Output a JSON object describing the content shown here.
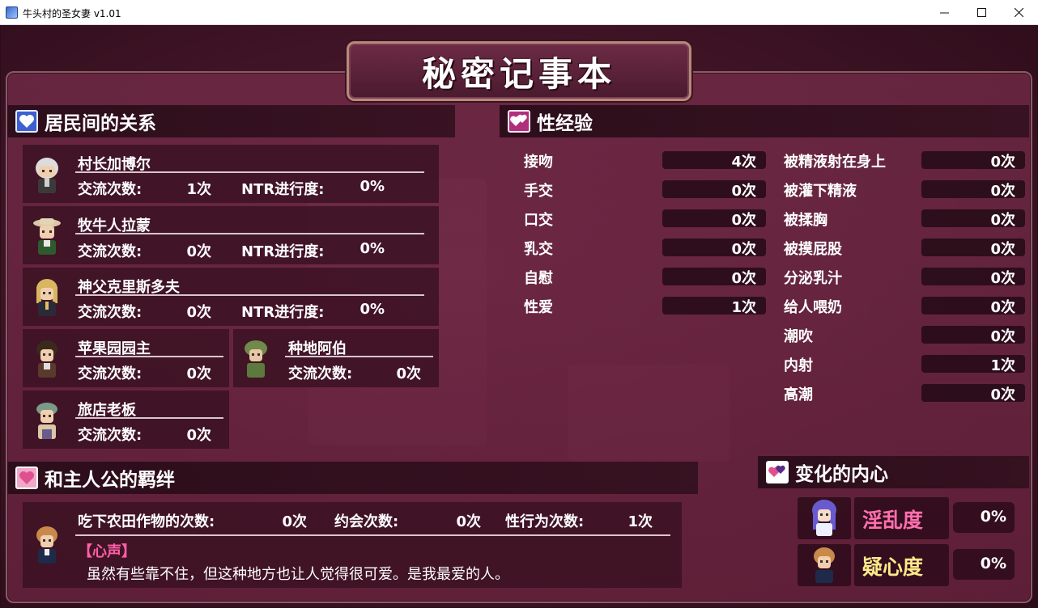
{
  "window": {
    "title": "牛头村的圣女妻 v1.01",
    "minimize": "—",
    "maximize": "☐",
    "close": "✕"
  },
  "page_title": "秘密记事本",
  "relations": {
    "header": "居民间的关系",
    "talk_label": "交流次数:",
    "ntr_label": "NTR进行度:",
    "residents": [
      {
        "name": "村长加博尔",
        "talk": "1次",
        "ntr": "0%"
      },
      {
        "name": "牧牛人拉蒙",
        "talk": "0次",
        "ntr": "0%"
      },
      {
        "name": "神父克里斯多夫",
        "talk": "0次",
        "ntr": "0%"
      },
      {
        "name": "苹果园园主",
        "talk": "0次"
      },
      {
        "name": "种地阿伯",
        "talk": "0次"
      },
      {
        "name": "旅店老板",
        "talk": "0次"
      }
    ]
  },
  "experience": {
    "header": "性经验",
    "left": [
      {
        "label": "接吻",
        "value": "4次"
      },
      {
        "label": "手交",
        "value": "0次"
      },
      {
        "label": "口交",
        "value": "0次"
      },
      {
        "label": "乳交",
        "value": "0次"
      },
      {
        "label": "自慰",
        "value": "0次"
      },
      {
        "label": "性爱",
        "value": "1次"
      }
    ],
    "right": [
      {
        "label": "被精液射在身上",
        "value": "0次"
      },
      {
        "label": "被灌下精液",
        "value": "0次"
      },
      {
        "label": "被揉胸",
        "value": "0次"
      },
      {
        "label": "被摸屁股",
        "value": "0次"
      },
      {
        "label": "分泌乳汁",
        "value": "0次"
      },
      {
        "label": "给人喂奶",
        "value": "0次"
      },
      {
        "label": "潮吹",
        "value": "0次"
      },
      {
        "label": "内射",
        "value": "1次"
      },
      {
        "label": "高潮",
        "value": "0次"
      }
    ]
  },
  "bond": {
    "header": "和主人公的羁绊",
    "crops_label": "吃下农田作物的次数:",
    "crops_value": "0次",
    "date_label": "约会次数:",
    "date_value": "0次",
    "sex_label": "性行为次数:",
    "sex_value": "1次",
    "voice_label": "【心声】",
    "voice_text": "虽然有些靠不住，但这种地方也让人觉得很可爱。是我最爱的人。"
  },
  "heart_change": {
    "header": "变化的内心",
    "lewd_label": "淫乱度",
    "lewd_value": "0%",
    "suspicion_label": "疑心度",
    "suspicion_value": "0%"
  },
  "colors": {
    "lewd": "#ff6fae",
    "suspicion": "#ffe98a",
    "voice": "#ff5fa8",
    "panel": "#6e2442"
  }
}
